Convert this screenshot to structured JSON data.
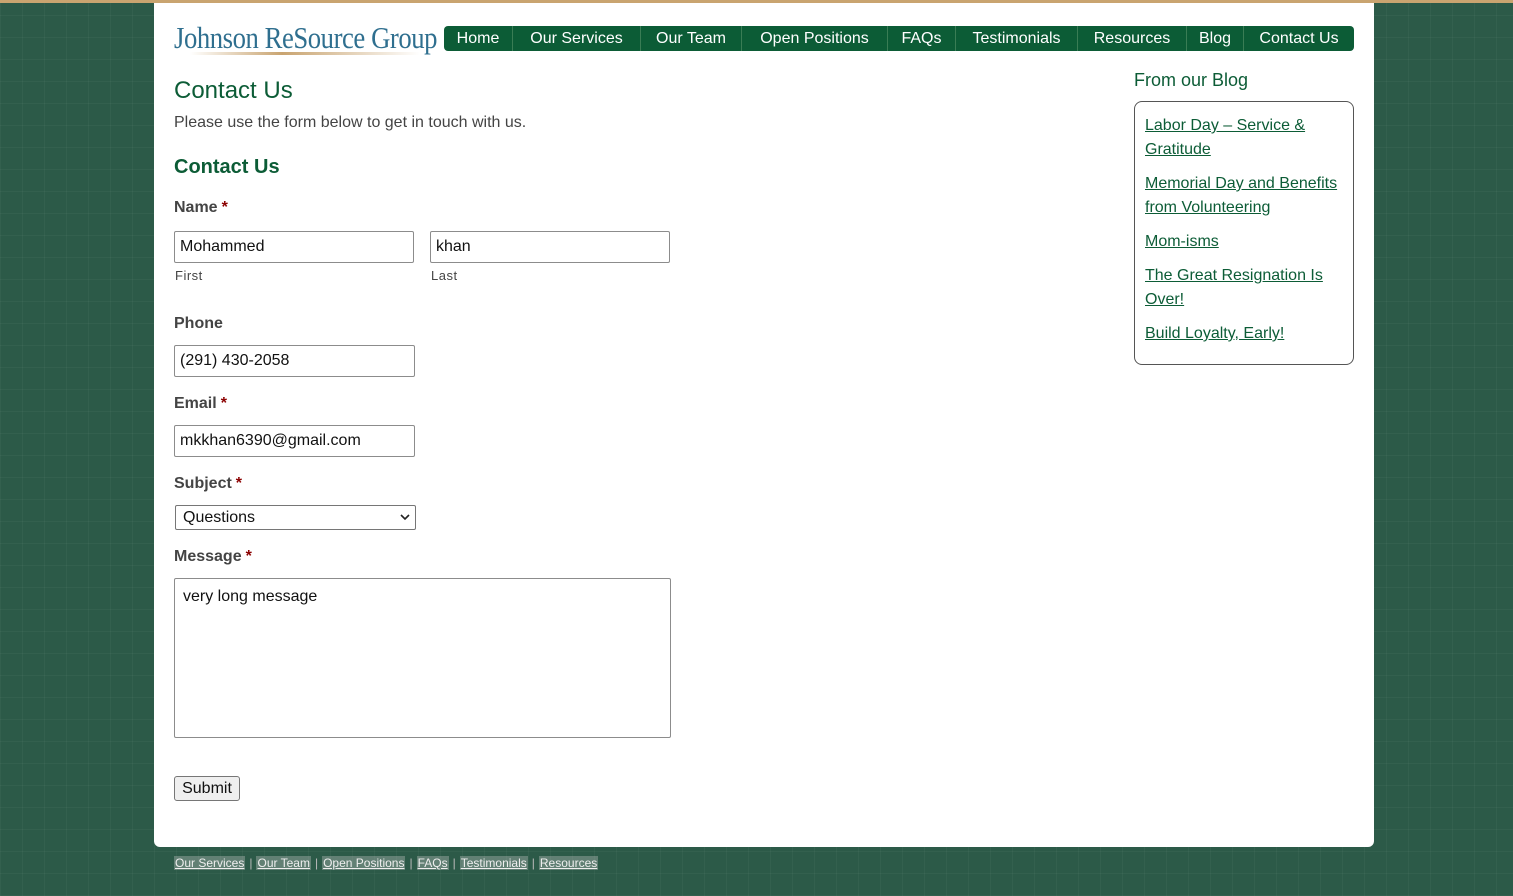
{
  "header": {
    "logo_text": "Johnson ReSource Group",
    "nav": [
      "Home",
      "Our Services",
      "Our Team",
      "Open Positions",
      "FAQs",
      "Testimonials",
      "Resources",
      "Blog",
      "Contact Us"
    ]
  },
  "main": {
    "title": "Contact Us",
    "intro": "Please use the form below to get in touch with us."
  },
  "form": {
    "title": "Contact Us",
    "required_mark": "*",
    "name_label": "Name",
    "first_value": "Mohammed",
    "first_sublabel": "First",
    "last_value": "khan",
    "last_sublabel": "Last",
    "phone_label": "Phone",
    "phone_value": "(291) 430-2058",
    "email_label": "Email",
    "email_value": "mkkhan6390@gmail.com",
    "subject_label": "Subject",
    "subject_value": "Questions",
    "message_label": "Message",
    "message_value": "very long message",
    "submit_label": "Submit"
  },
  "sidebar": {
    "title": "From our Blog",
    "links": [
      "Labor Day – Service & Gratitude",
      "Memorial Day and Benefits from Volunteering",
      "Mom-isms",
      "The Great Resignation Is Over!",
      "Build Loyalty, Early!"
    ]
  },
  "footer": {
    "links": [
      "Our Services",
      "Our Team",
      "Open Positions",
      "FAQs",
      "Testimonials",
      "Resources"
    ],
    "separator": "|"
  },
  "colors": {
    "brand_green": "#0c5c36",
    "background": "#2c5a48",
    "accent_gold": "#c9a470"
  }
}
